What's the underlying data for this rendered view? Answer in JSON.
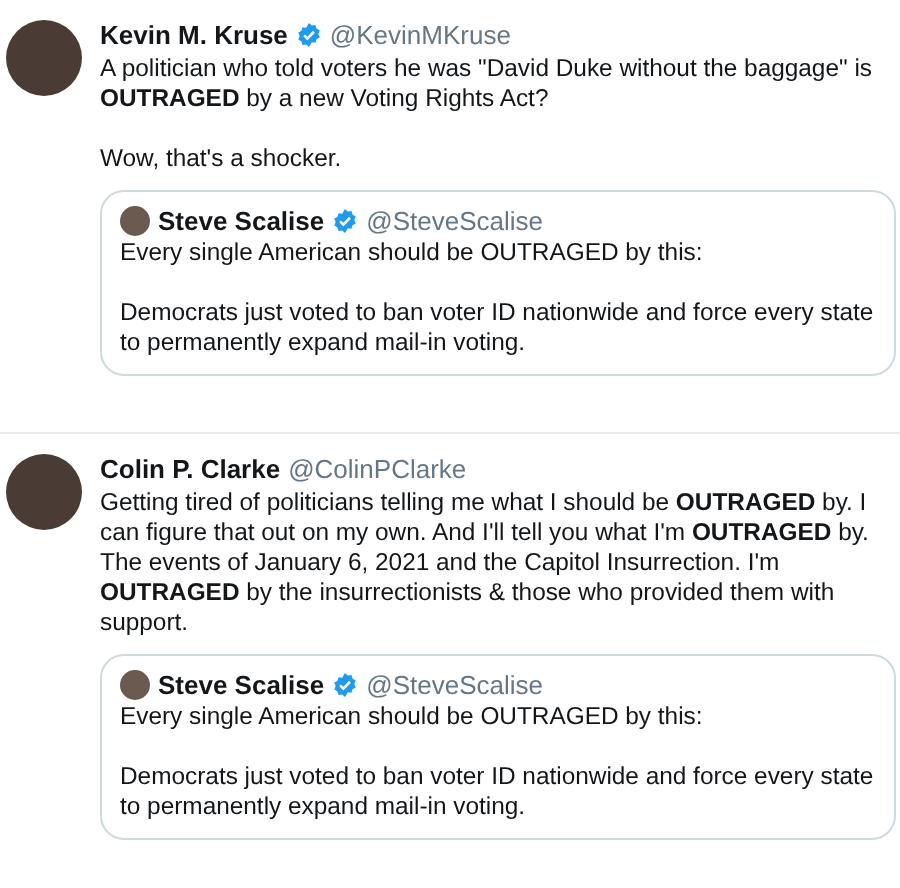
{
  "tweets": [
    {
      "name": "Kevin M. Kruse",
      "verified": true,
      "handle": "@KevinMKruse",
      "paragraphs": [
        "A politician who told voters he was \"David Duke without the baggage\" is **OUTRAGED** by a new Voting Rights Act?",
        "Wow, that's a shocker."
      ],
      "quote": {
        "name": "Steve Scalise",
        "verified": true,
        "handle": "@SteveScalise",
        "paragraphs": [
          "Every single American should be OUTRAGED by this:",
          "Democrats just voted to ban voter ID nationwide and force every state to permanently expand mail-in voting."
        ]
      }
    },
    {
      "name": "Colin P. Clarke",
      "verified": false,
      "handle": "@ColinPClarke",
      "paragraphs": [
        "Getting tired of politicians telling me what I should be **OUTRAGED** by. I can figure that out on my own. And I'll tell you what I'm **OUTRAGED** by. The events of January 6, 2021 and the Capitol Insurrection. I'm **OUTRAGED** by the insurrectionists & those who provided them with support."
      ],
      "quote": {
        "name": "Steve Scalise",
        "verified": true,
        "handle": "@SteveScalise",
        "paragraphs": [
          "Every single American should be OUTRAGED by this:",
          "Democrats just voted to ban voter ID nationwide and force every state to permanently expand mail-in voting."
        ]
      }
    }
  ]
}
